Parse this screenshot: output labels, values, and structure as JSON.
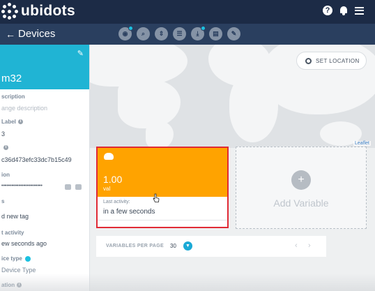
{
  "app": {
    "brand": "ubidots"
  },
  "header": {
    "help_icon": "question-circle-icon",
    "notifications_icon": "bell-icon",
    "menu_icon": "hamburger-menu-icon"
  },
  "subbar": {
    "back_label": "Devices",
    "tools": [
      "eye-icon",
      "search-icon",
      "sort-icon",
      "list-icon",
      "download-icon",
      "clipboard-icon",
      "wrench-icon"
    ]
  },
  "device": {
    "name_partial": "m32",
    "description_label": "scription",
    "description_placeholder": "ange description",
    "api_label": "Label",
    "api_value": "3",
    "id_value": "c36d473efc33dc7b15c49",
    "token_label": "ion",
    "token_value": "••••••••••••••••••••••••",
    "tags_label": "s",
    "tags_value": "d new tag",
    "last_activity_label": "t activity",
    "last_activity_value": "ew seconds ago",
    "device_type_label": "ice type",
    "device_type_value": "Device Type",
    "location_label": "ation"
  },
  "map": {
    "set_location_label": "SET LOCATION",
    "attribution": "Leaflet"
  },
  "variable": {
    "value": "1.00",
    "name": "val",
    "last_activity_label": "Last activity:",
    "last_activity_value": "in a few seconds",
    "accent": "#ffa300"
  },
  "add_variable": {
    "label": "Add Variable",
    "plus": "+"
  },
  "pagination": {
    "label": "VARIABLES PER PAGE",
    "count": "30",
    "prev": "‹",
    "next": "›"
  },
  "colors": {
    "topbar": "#1c2b46",
    "subbar": "#2a3f5f",
    "device_header": "#20b4d4",
    "highlight_border": "#e02a35"
  }
}
